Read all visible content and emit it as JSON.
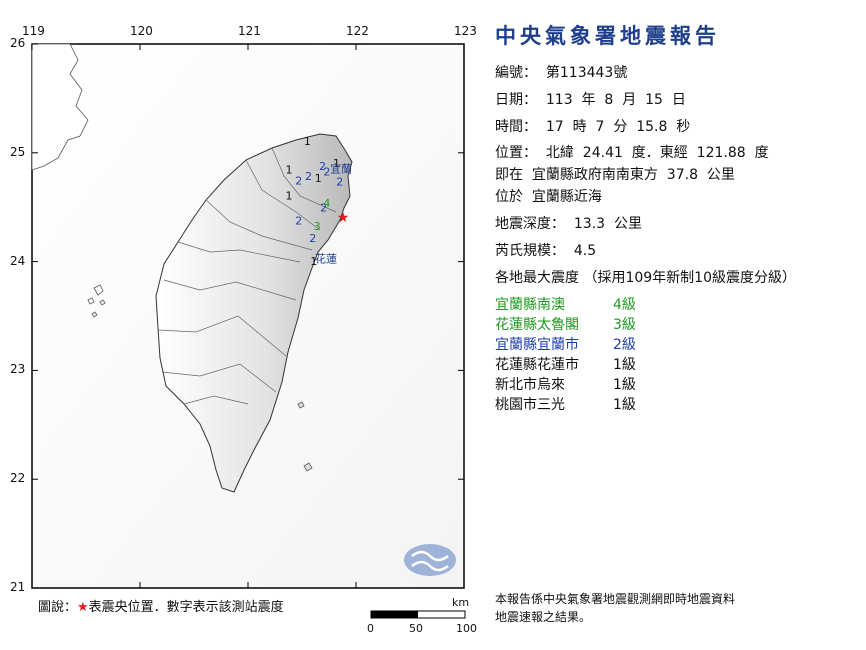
{
  "map": {
    "lon_ticks": [
      "119",
      "120",
      "121",
      "122",
      "123"
    ],
    "lat_ticks": [
      "26",
      "25",
      "24",
      "23",
      "22",
      "21"
    ],
    "lon_range": [
      119,
      123
    ],
    "lat_range": [
      21,
      26
    ],
    "epicenter": {
      "lon": 121.88,
      "lat": 24.41
    },
    "station_labels": [
      {
        "value": "1",
        "lon": 121.55,
        "lat": 25.07,
        "color": "#111111"
      },
      {
        "value": "1",
        "lon": 121.82,
        "lat": 24.87,
        "color": "#111111"
      },
      {
        "value": "1",
        "lon": 121.38,
        "lat": 24.81,
        "color": "#111111"
      },
      {
        "value": "1",
        "lon": 121.65,
        "lat": 24.73,
        "color": "#111111"
      },
      {
        "value": "1",
        "lon": 121.38,
        "lat": 24.57,
        "color": "#111111"
      },
      {
        "value": "1",
        "lon": 121.61,
        "lat": 23.97,
        "color": "#111111"
      },
      {
        "value": "2",
        "lon": 121.69,
        "lat": 24.84,
        "color": "#1f3ea8"
      },
      {
        "value": "2",
        "lon": 121.73,
        "lat": 24.79,
        "color": "#1f3ea8"
      },
      {
        "value": "2",
        "lon": 121.56,
        "lat": 24.75,
        "color": "#1f3ea8"
      },
      {
        "value": "2",
        "lon": 121.47,
        "lat": 24.71,
        "color": "#1f3ea8"
      },
      {
        "value": "2",
        "lon": 121.85,
        "lat": 24.7,
        "color": "#1f3ea8"
      },
      {
        "value": "2",
        "lon": 121.7,
        "lat": 24.46,
        "color": "#1f3ea8"
      },
      {
        "value": "2",
        "lon": 121.47,
        "lat": 24.34,
        "color": "#1f3ea8"
      },
      {
        "value": "2",
        "lon": 121.6,
        "lat": 24.18,
        "color": "#1f3ea8"
      },
      {
        "value": "3",
        "lon": 121.64,
        "lat": 24.29,
        "color": "#1f9a1f"
      },
      {
        "value": "4",
        "lon": 121.73,
        "lat": 24.5,
        "color": "#1f9a1f"
      }
    ],
    "place_labels": [
      {
        "text": "宜蘭",
        "lon": 121.76,
        "lat": 24.82
      },
      {
        "text": "花蓮",
        "lon": 121.62,
        "lat": 23.99
      }
    ],
    "legend_text": "圖說：",
    "legend_star": "★",
    "legend_rest": "表震央位置．數字表示該測站震度",
    "scale": {
      "unit": "km",
      "labels": [
        "0",
        "50",
        "100"
      ]
    }
  },
  "report": {
    "title": "中央氣象署地震報告",
    "number": "編號：  第113443號",
    "date": "日期：  113  年  8  月  15  日",
    "time": "時間：  17  時  7  分  15.8  秒",
    "position": "位置：  北緯  24.41  度．東經  121.88  度",
    "relative": "即在  宜蘭縣政府南南東方  37.8  公里",
    "located": "位於  宜蘭縣近海",
    "depth": "地震深度：  13.3  公里",
    "magnitude": "芮氏規模：  4.5",
    "intensity_header": "各地最大震度 （採用109年新制10級震度分級）",
    "intensities": [
      {
        "place": "宜蘭縣南澳",
        "level": "4級",
        "color": "#1f9a1f"
      },
      {
        "place": "花蓮縣太魯閣",
        "level": "3級",
        "color": "#1f9a1f"
      },
      {
        "place": "宜蘭縣宜蘭市",
        "level": "2級",
        "color": "#1f3ea8"
      },
      {
        "place": "花蓮縣花蓮市",
        "level": "1級",
        "color": "#111111"
      },
      {
        "place": "新北市烏來",
        "level": "1級",
        "color": "#111111"
      },
      {
        "place": "桃園市三光",
        "level": "1級",
        "color": "#111111"
      }
    ],
    "footnote_1": "本報告係中央氣象署地震觀測網即時地震資料",
    "footnote_2": "地震速報之結果。"
  }
}
